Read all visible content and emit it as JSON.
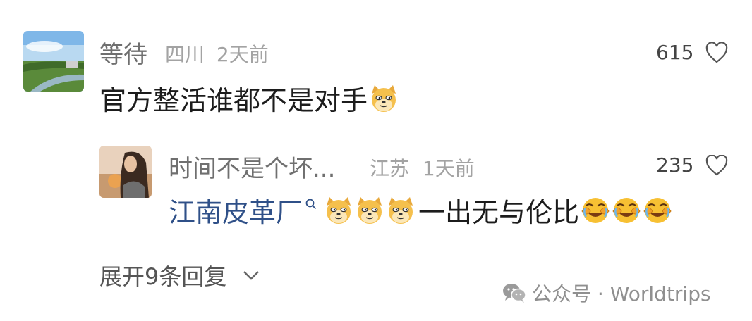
{
  "comment": {
    "author": "等待",
    "location": "四川",
    "time": "2天前",
    "likes": "615",
    "text": "官方整活谁都不是对手",
    "emojis": [
      "doge-emoji"
    ]
  },
  "reply": {
    "author": "时间不是个坏...",
    "location": "江苏",
    "time": "1天前",
    "likes": "235",
    "link_text": "江南皮革厂",
    "text": "一出无与伦比",
    "emojis_before": [
      "doge-emoji",
      "doge-emoji",
      "doge-emoji"
    ],
    "emojis_after": [
      "laugh-cry-emoji",
      "laugh-cry-emoji",
      "laugh-cry-emoji"
    ]
  },
  "expand_label": "展开9条回复",
  "watermark": "公众号 · Worldtrips",
  "colors": {
    "link": "#2f5088",
    "meta": "#a3a3a3"
  }
}
